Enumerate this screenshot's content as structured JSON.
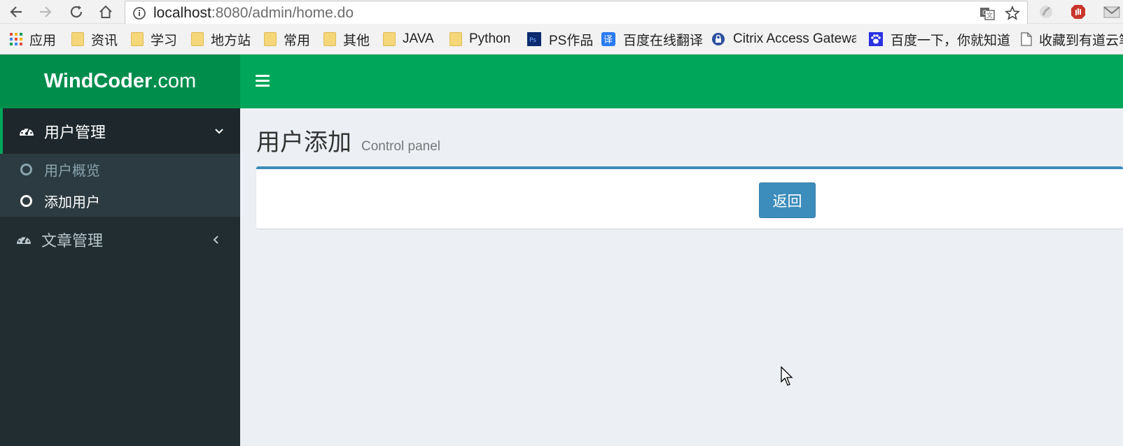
{
  "browser": {
    "url_host": "localhost",
    "url_rest": ":8080/admin/home.do",
    "bookmarks": [
      {
        "label": "应用",
        "icon": "apps-grid-icon"
      },
      {
        "label": "资讯",
        "icon": "folder-icon"
      },
      {
        "label": "学习",
        "icon": "folder-icon"
      },
      {
        "label": "地方站",
        "icon": "folder-icon"
      },
      {
        "label": "常用",
        "icon": "folder-icon"
      },
      {
        "label": "其他",
        "icon": "folder-icon"
      },
      {
        "label": "JAVA",
        "icon": "folder-icon"
      },
      {
        "label": "Python",
        "icon": "folder-icon"
      },
      {
        "label": "PS作品",
        "icon": "ps-icon"
      },
      {
        "label": "百度在线翻译",
        "icon": "translate-icon"
      },
      {
        "label": "Citrix Access Gatewa",
        "icon": "citrix-icon"
      },
      {
        "label": "百度一下，你就知道",
        "icon": "baidu-paw-icon"
      },
      {
        "label": "收藏到有道云笔",
        "icon": "page-icon"
      }
    ]
  },
  "header": {
    "logo_bold": "WindCoder",
    "logo_light": ".com"
  },
  "sidebar": {
    "menu": [
      {
        "label": "用户管理",
        "expanded": true,
        "children": [
          {
            "label": "用户概览"
          },
          {
            "label": "添加用户"
          }
        ]
      },
      {
        "label": "文章管理",
        "expanded": false
      }
    ]
  },
  "content": {
    "title": "用户添加",
    "subtitle": "Control panel",
    "back_button": "返回"
  },
  "colors": {
    "navbar": "#00a65a",
    "logo_bg": "#008d4c",
    "sidebar": "#222d32",
    "submenu": "#2c3b41",
    "primary": "#3c8dbc",
    "content_bg": "#ecf0f5"
  }
}
